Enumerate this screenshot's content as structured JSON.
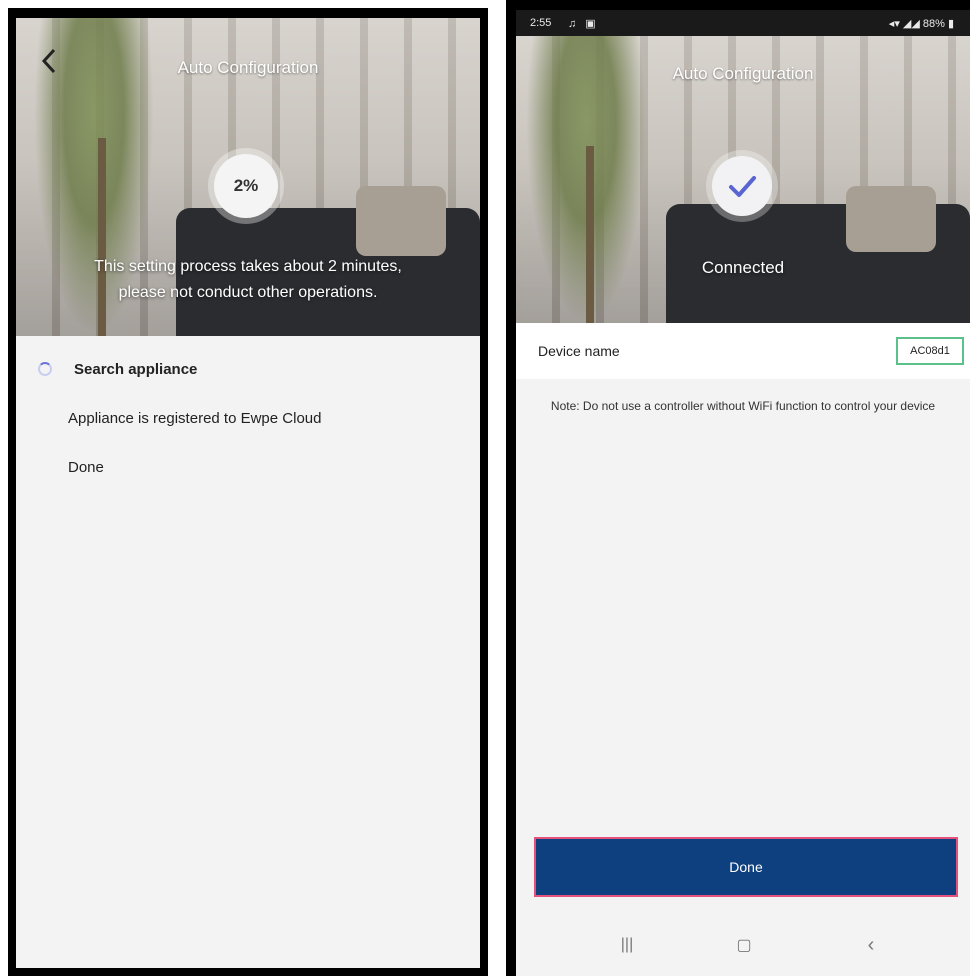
{
  "left": {
    "title": "Auto Configuration",
    "progress_text": "2%",
    "progress_value": 0.02,
    "message_line1": "This setting process takes about 2 minutes,",
    "message_line2": "please not conduct other operations.",
    "steps": [
      {
        "label": "Search appliance",
        "state": "in-progress"
      },
      {
        "label": "Appliance is registered to Ewpe Cloud",
        "state": "pending"
      },
      {
        "label": "Done",
        "state": "pending"
      }
    ]
  },
  "right": {
    "status_bar": {
      "time": "2:55",
      "left_icons": "♫ ▣",
      "right_icons": "◂▾ ◢◢ 88% ▮"
    },
    "title": "Auto Configuration",
    "connected_label": "Connected",
    "device_name_label": "Device name",
    "device_name_value": "AC08d1",
    "note": "Note: Do not use a controller without WiFi function to control your device",
    "done_button": "Done",
    "nav": {
      "recents": "|||",
      "home": "▢",
      "back": "‹"
    }
  },
  "colors": {
    "done_button": "#0e3f7f",
    "done_border": "#e4527b",
    "input_border": "#5cc08a",
    "spinner": "#6c74d8",
    "check": "#5a64d2"
  }
}
